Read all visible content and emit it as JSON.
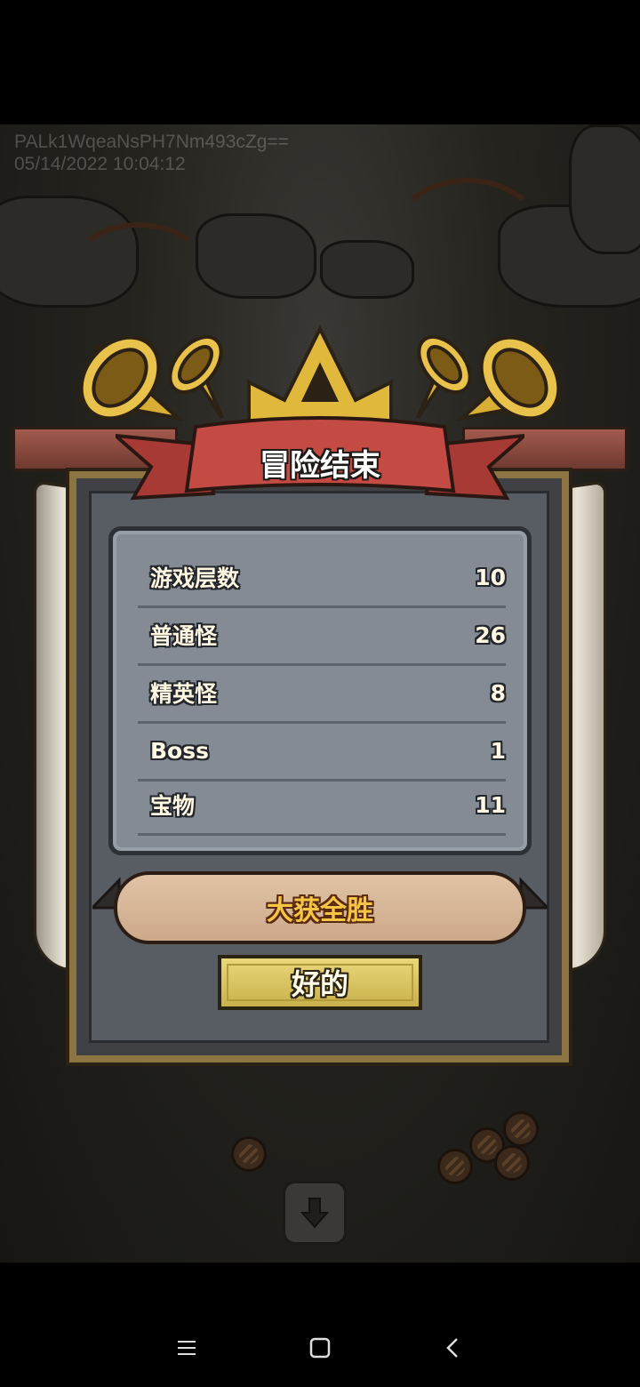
{
  "watermark": {
    "id_text": "PALk1WqeaNsPH7Nm493cZg==",
    "timestamp": "05/14/2022 10:04:12"
  },
  "dialog": {
    "title": "冒险结束",
    "stats": [
      {
        "label": "游戏层数",
        "value": "10"
      },
      {
        "label": "普通怪",
        "value": "26"
      },
      {
        "label": "精英怪",
        "value": "8"
      },
      {
        "label": "Boss",
        "value": "1"
      },
      {
        "label": "宝物",
        "value": "11"
      }
    ],
    "result_banner": "大获全胜",
    "ok_button": "好的"
  },
  "colors": {
    "title_ribbon": "#c44a44",
    "crown_gold": "#e0b83c",
    "banner_text": "#f5c545",
    "button_gold": "#d9c25a"
  },
  "icons": {
    "scroll_down": "arrow-down-icon",
    "nav_menu": "menu-icon",
    "nav_home": "square-icon",
    "nav_back": "chevron-left-icon"
  }
}
